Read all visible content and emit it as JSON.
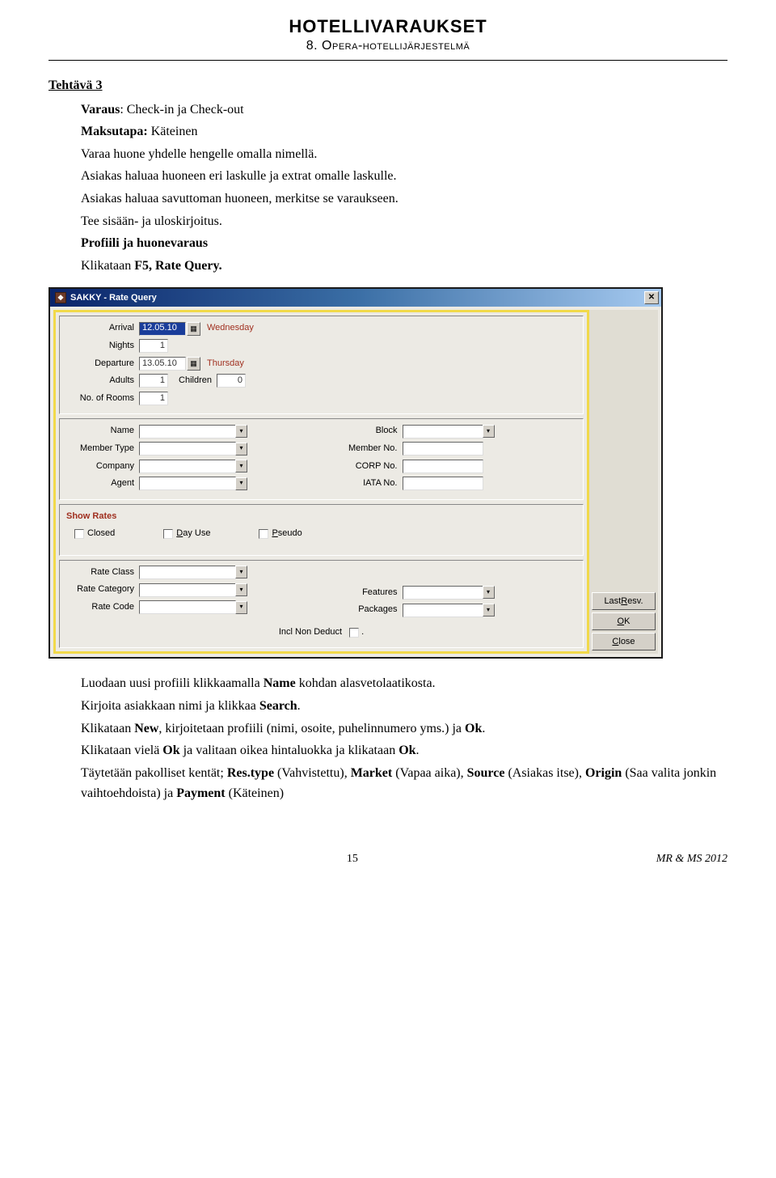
{
  "header": {
    "title": "Hotellivaraukset",
    "subtitle": "8. Opera-hotellijärjestelmä"
  },
  "task": {
    "heading": "Tehtävä 3",
    "lines": {
      "l1a": "Varaus",
      "l1b": ": Check-in ja Check-out",
      "l2a": "Maksutapa:",
      "l2b": " Käteinen",
      "l3": "Varaa huone yhdelle hengelle omalla nimellä.",
      "l4": "Asiakas haluaa huoneen eri laskulle ja extrat omalle laskulle.",
      "l5": "Asiakas haluaa savuttoman huoneen, merkitse se varaukseen.",
      "l6": "Tee sisään- ja uloskirjoitus.",
      "l7": "Profiili ja huonevaraus",
      "l8a": "Klikataan ",
      "l8b": "F5, Rate Query."
    }
  },
  "dialog": {
    "title": "SAKKY - Rate Query",
    "panel1": {
      "arrival_lbl": "Arrival",
      "arrival_val": "12.05.10",
      "arrival_day": "Wednesday",
      "nights_lbl": "Nights",
      "nights_val": "1",
      "departure_lbl": "Departure",
      "departure_val": "13.05.10",
      "departure_day": "Thursday",
      "adults_lbl": "Adults",
      "adults_val": "1",
      "children_lbl": "Children",
      "children_val": "0",
      "rooms_lbl": "No. of Rooms",
      "rooms_val": "1"
    },
    "panel2": {
      "name_lbl": "Name",
      "member_type_lbl": "Member Type",
      "company_lbl": "Company",
      "agent_lbl": "Agent",
      "block_lbl": "Block",
      "member_no_lbl": "Member No.",
      "corp_no_lbl": "CORP No.",
      "iata_no_lbl": "IATA No."
    },
    "panel3": {
      "title": "Show Rates",
      "closed": "Closed",
      "dayuse_pre": "D",
      "dayuse_post": "ay Use",
      "pseudo_pre": "P",
      "pseudo_post": "seudo"
    },
    "panel4": {
      "rate_class_lbl": "Rate Class",
      "rate_category_lbl": "Rate Category",
      "rate_code_lbl": "Rate Code",
      "features_lbl": "Features",
      "packages_lbl": "Packages",
      "incl_lbl": "Incl Non Deduct",
      "dot": "."
    },
    "buttons": {
      "last_resv_pre": "Last ",
      "last_resv_u": "R",
      "last_resv_post": "esv.",
      "ok_u": "O",
      "ok_post": "K",
      "close_u": "C",
      "close_post": "lose"
    }
  },
  "after": {
    "l1a": "Luodaan uusi profiili klikkaamalla ",
    "l1b": "Name",
    "l1c": " kohdan alasvetolaatikosta.",
    "l2a": "Kirjoita asiakkaan nimi ja klikkaa ",
    "l2b": "Search",
    "l2c": ".",
    "l3a": "Klikataan ",
    "l3b": "New",
    "l3c": ", kirjoitetaan profiili (nimi, osoite, puhelinnumero yms.)  ja ",
    "l3d": "Ok",
    "l3e": ".",
    "l4a": "Klikataan vielä ",
    "l4b": "Ok",
    "l4c": " ja valitaan oikea hintaluokka ja klikataan ",
    "l4d": "Ok",
    "l4e": ".",
    "l5a": "Täytetään pakolliset kentät; ",
    "l5b": "Res.type",
    "l5c": " (Vahvistettu), ",
    "l5d": "Market",
    "l5e": " (Vapaa aika), ",
    "l5f": "Source",
    "l5g": " (Asiakas itse), ",
    "l5h": "Origin",
    "l5i": " (Saa valita jonkin vaihtoehdoista) ja ",
    "l5j": "Payment",
    "l5k": " (Käteinen)"
  },
  "footer": {
    "page": "15",
    "credit": "MR & MS 2012"
  }
}
